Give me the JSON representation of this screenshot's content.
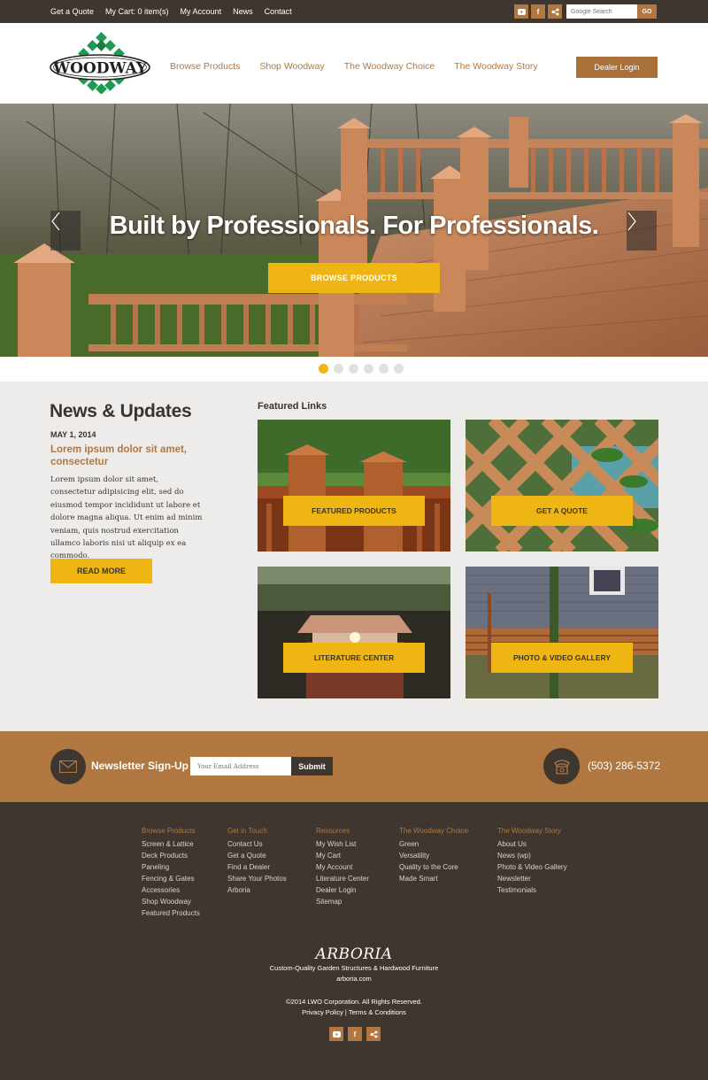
{
  "topbar": {
    "links": [
      "Get a Quote",
      "My Cart: 0 item(s)",
      "My Account",
      "News",
      "Contact"
    ],
    "search_placeholder": "Google Search",
    "go_label": "GO",
    "social": [
      "youtube-icon",
      "facebook-icon",
      "share-icon"
    ]
  },
  "header": {
    "logo_text": "WOODWAY",
    "nav": [
      "Browse Products",
      "Shop Woodway",
      "The Woodway Choice",
      "The Woodway Story"
    ],
    "dealer_login": "Dealer Login"
  },
  "hero": {
    "title": "Built by Professionals. For Professionals.",
    "button": "BROWSE PRODUCTS",
    "slides": 6,
    "active_slide": 1
  },
  "news": {
    "title": "News & Updates",
    "date": "MAY 1, 2014",
    "headline": "Lorem ipsum dolor sit amet, consectetur",
    "body": "Lorem ipsum dolor sit amet, consectetur adipisicing elit, sed do eiusmod tempor incididunt ut labore et dolore magna aliqua. Ut enim ad minim veniam, quis nostrud exercitation ullamco laboris nisi ut aliquip ex ea commodo.",
    "read_more": "READ MORE"
  },
  "featured": {
    "title": "Featured Links",
    "tiles": [
      "FEATURED PRODUCTS",
      "GET A QUOTE",
      "LITERATURE CENTER",
      "PHOTO & VIDEO GALLERY"
    ]
  },
  "newsletter": {
    "label": "Newsletter Sign-Up",
    "placeholder": "Your Email Address",
    "submit": "Submit",
    "phone": "(503) 286-5372"
  },
  "footer": {
    "columns": [
      {
        "heading": "Browse Products",
        "items": [
          "Screen & Lattice",
          "Deck Products",
          "Paneling",
          "Fencing & Gates",
          "Accessories",
          "Shop Woodway",
          "Featured Products"
        ]
      },
      {
        "heading": "Get in Touch",
        "items": [
          "Contact Us",
          "Get a Quote",
          "Find a Dealer",
          "Share Your Photos",
          "Arboria"
        ]
      },
      {
        "heading": "Resources",
        "items": [
          "My Wish List",
          "My Cart",
          "My Account",
          "Literature Center",
          "Dealer Login",
          "Sitemap"
        ]
      },
      {
        "heading": "The Woodway Choice",
        "items": [
          "Green",
          "Versatility",
          "Quality to the Core",
          "Made Smart"
        ]
      },
      {
        "heading": "The Woodway Story",
        "items": [
          "About Us",
          "News (wp)",
          "Photo & Video Gallery",
          "Newsletter",
          "Testimonials"
        ]
      }
    ],
    "arboria_logo": "ARBORIA",
    "arboria_tagline": "Custom-Quality Garden Structures & Hardwood Furniture",
    "arboria_url": "arboria.com",
    "copyright": "©2014 LWO Corporation. All Rights Reserved.",
    "privacy": "Privacy Policy",
    "separator": "|",
    "terms": "Terms & Conditions"
  },
  "colors": {
    "dark_brown": "#3f3630",
    "accent_brown": "#b07840",
    "yellow": "#efb613",
    "logo_green": "#1e9a54"
  }
}
